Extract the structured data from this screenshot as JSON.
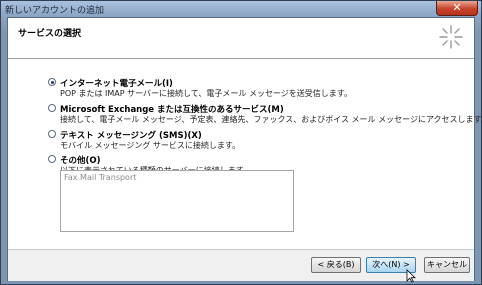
{
  "window": {
    "title": "新しいアカウントの追加",
    "close_label": "✕"
  },
  "header": {
    "title": "サービスの選択",
    "icon": "wizard-sparkle-icon"
  },
  "options": [
    {
      "label": "インターネット電子メール(I)",
      "description": "POP または IMAP サーバーに接続して、電子メール メッセージを送受信します。",
      "selected": true
    },
    {
      "label": "Microsoft Exchange または互換性のあるサービス(M)",
      "description": "接続して、電子メール メッセージ、予定表、連絡先、ファックス、およびボイス メール メッセージにアクセスします。",
      "selected": false
    },
    {
      "label": "テキスト メッセージング (SMS)(X)",
      "description": "モバイル メッセージング サービスに接続します。",
      "selected": false
    },
    {
      "label": "その他(O)",
      "description": "以下に表示されている種類のサーバーに接続します。",
      "selected": false
    }
  ],
  "other_list": {
    "items": [
      "Fax Mail Transport"
    ]
  },
  "buttons": {
    "back": "< 戻る(B)",
    "next": "次へ(N) >",
    "cancel": "キャンセル"
  },
  "colors": {
    "accent": "#1f3b6e",
    "titlebar": "#8fa9c8",
    "close": "#c7432b"
  }
}
